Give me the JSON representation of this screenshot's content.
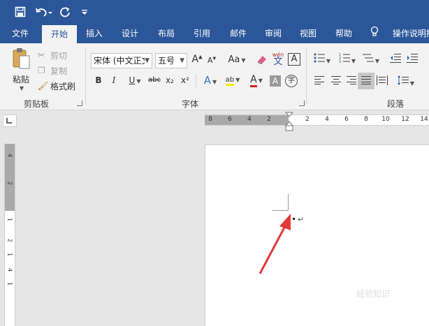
{
  "colors": {
    "brand": "#2b579a",
    "ribbon_bg": "#f3f3f3",
    "arrow": "#e03a3a"
  },
  "title_bar": {
    "quick_access": [
      "save-icon",
      "undo-icon",
      "redo-icon",
      "customize-qat-icon"
    ]
  },
  "tabs": [
    {
      "label": "文件"
    },
    {
      "label": "开始",
      "active": true
    },
    {
      "label": "插入"
    },
    {
      "label": "设计"
    },
    {
      "label": "布局"
    },
    {
      "label": "引用"
    },
    {
      "label": "邮件"
    },
    {
      "label": "审阅"
    },
    {
      "label": "视图"
    },
    {
      "label": "帮助"
    }
  ],
  "tell_me": {
    "label": "操作说明搜"
  },
  "clipboard": {
    "paste": "粘贴",
    "cut": "剪切",
    "copy": "复制",
    "format_painter": "格式刷",
    "group_label": "剪贴板"
  },
  "font": {
    "font_name": "宋体 (中文正文",
    "font_size": "五号",
    "grow": "A",
    "shrink": "A",
    "change_case": "Aa",
    "phonetic": "wén",
    "phonetic_char": "文",
    "border_char": "A",
    "bold": "B",
    "italic": "I",
    "underline": "U",
    "strikethrough": "abc",
    "subscript": "x₂",
    "superscript": "x²",
    "text_effects": "A",
    "highlight": "ab",
    "font_color": "A",
    "char_shading": "A",
    "enclose": "字",
    "group_label": "字体"
  },
  "paragraph": {
    "group_label": "段落"
  },
  "ruler": {
    "horizontal_ticks": [
      "8",
      "6",
      "4",
      "2",
      "2",
      "4",
      "6",
      "8",
      "10",
      "12",
      "14"
    ],
    "vertical_ticks": [
      "4",
      "2",
      "1",
      "2",
      "1",
      "4",
      "1"
    ]
  },
  "document": {
    "paragraph_mark": "↵"
  },
  "watermark": "经验知识"
}
